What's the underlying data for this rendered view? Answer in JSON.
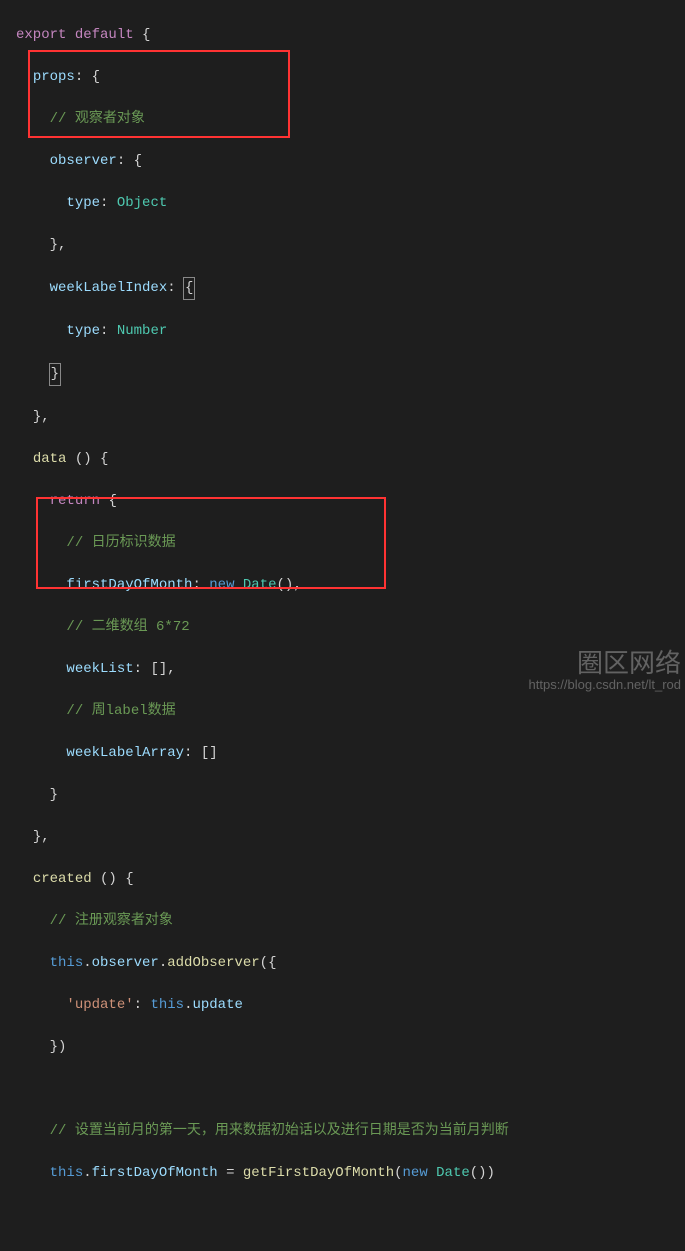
{
  "code": {
    "export": "export",
    "default": "default",
    "props_key": "props",
    "comment_observer": "// 观察者对象",
    "observer_key": "observer",
    "type_key": "type",
    "type_object": "Object",
    "weekLabelIndex_key": "weekLabelIndex",
    "type_number": "Number",
    "data_key": "data",
    "return": "return",
    "comment_calendar": "// 日历标识数据",
    "firstDayOfMonth_key": "firstDayOfMonth",
    "new": "new",
    "date_class": "Date",
    "comment_2darray": "// 二维数组 6*72",
    "weekList_key": "weekList",
    "comment_weeklabel": "// 周label数据",
    "weekLabelArray_key": "weekLabelArray",
    "created_key": "created",
    "comment_register": "// 注册观察者对象",
    "this": "this",
    "observer_prop": "observer",
    "addObserver_fn": "addObserver",
    "update_str": "'update'",
    "update_prop": "update",
    "comment_setmonth": "// 设置当前月的第一天，用来数据初始话以及进行日期是否为当前月判断",
    "firstDayOfMonth_prop": "firstDayOfMonth",
    "getFirstDayOfMonth_fn": "getFirstDayOfMonth"
  },
  "watermark": {
    "main": "圈区网络",
    "sub": "https://blog.csdn.net/lt_rod"
  },
  "chart_data": null
}
